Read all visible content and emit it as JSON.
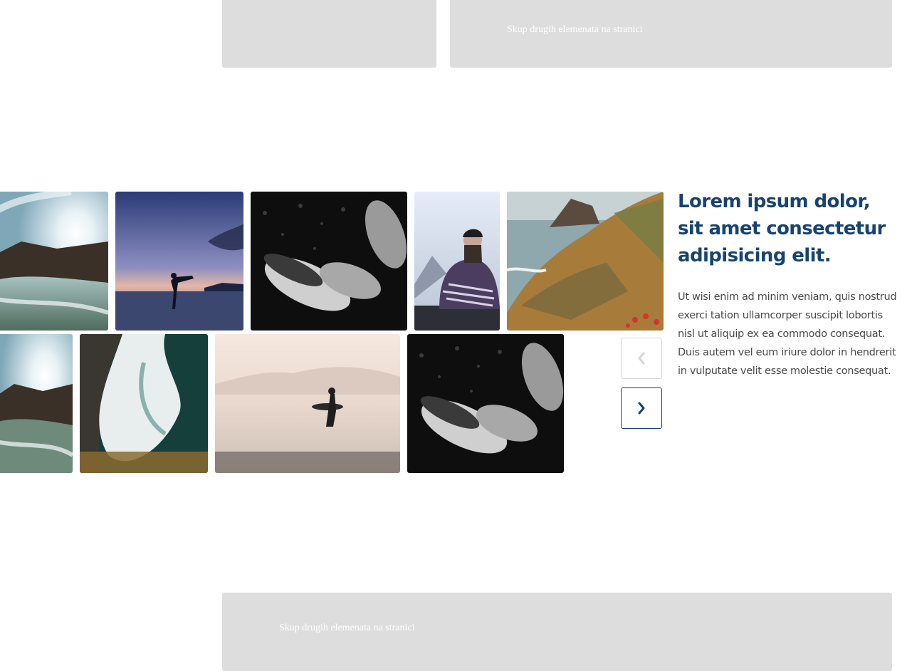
{
  "placeholders": {
    "top_right_label": "Skup drugih elemenata na stranici",
    "bottom_label": "Skup drugih elemenata na stranici"
  },
  "gallery": {
    "row1": [
      {
        "name": "photo-wave-sun",
        "subject": "ocean wave with sun flare"
      },
      {
        "name": "photo-kick-silhouette",
        "subject": "person kicking on beach at dusk"
      },
      {
        "name": "photo-penguins",
        "subject": "penguins swimming underwater"
      },
      {
        "name": "photo-woman-blanket",
        "subject": "woman in blanket on car roof"
      },
      {
        "name": "photo-coastal-cliffs",
        "subject": "coastal cliffs with flowers"
      }
    ],
    "row2": [
      {
        "name": "photo-wave-sun-2",
        "subject": "ocean wave with sun flare"
      },
      {
        "name": "photo-shoreline",
        "subject": "aerial wave on sand"
      },
      {
        "name": "photo-surfer",
        "subject": "surfer walking on misty beach"
      },
      {
        "name": "photo-penguins-2",
        "subject": "penguins swimming underwater"
      }
    ]
  },
  "carousel": {
    "prev_icon": "chevron-left-icon",
    "next_icon": "chevron-right-icon",
    "prev_state": "disabled",
    "next_state": "enabled"
  },
  "content": {
    "heading": "Lorem ipsum dolor, sit amet consectetur adipisicing elit.",
    "body": "Ut wisi enim ad minim veniam, quis nostrud exerci tation ullamcorper suscipit lobortis nisl ut aliquip ex ea commodo consequat. Duis autem vel eum iriure dolor in hendrerit in vulputate velit esse molestie consequat."
  },
  "colors": {
    "accent": "#164373",
    "placeholder_bg": "#dddddd",
    "text": "#4a4a4a"
  }
}
